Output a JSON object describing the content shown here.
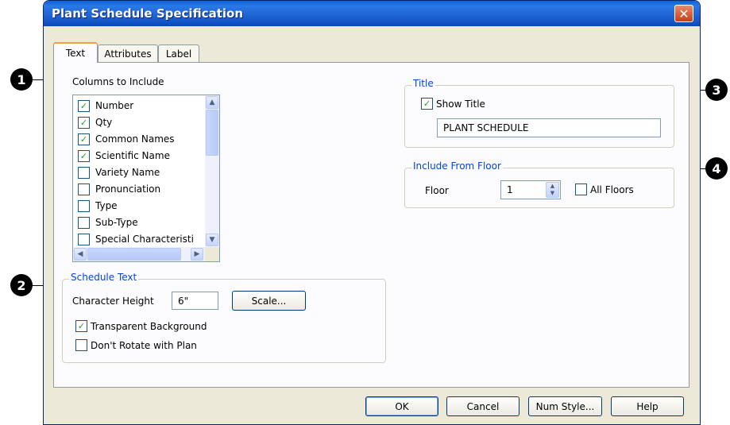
{
  "window": {
    "title": "Plant Schedule Specification"
  },
  "tabs": [
    {
      "label": "Text",
      "active": true
    },
    {
      "label": "Attributes",
      "active": false
    },
    {
      "label": "Label",
      "active": false
    }
  ],
  "columns": {
    "label": "Columns to Include",
    "items": [
      {
        "label": "Number",
        "checked": true
      },
      {
        "label": "Qty",
        "checked": true
      },
      {
        "label": "Common Names",
        "checked": true
      },
      {
        "label": "Scientific Name",
        "checked": true
      },
      {
        "label": "Variety Name",
        "checked": false
      },
      {
        "label": "Pronunciation",
        "checked": false
      },
      {
        "label": "Type",
        "checked": false
      },
      {
        "label": "Sub-Type",
        "checked": false
      },
      {
        "label": "Special Characteristi",
        "checked": false
      }
    ]
  },
  "schedule_text": {
    "legend": "Schedule Text",
    "char_height_label": "Character Height",
    "char_height_value": "6\"",
    "scale_button": "Scale...",
    "transparent_label": "Transparent Background",
    "transparent_checked": true,
    "dont_rotate_label": "Don't Rotate with Plan",
    "dont_rotate_checked": false
  },
  "title_group": {
    "legend": "Title",
    "show_title_label": "Show Title",
    "show_title_checked": true,
    "title_value": "PLANT SCHEDULE"
  },
  "floor_group": {
    "legend": "Include From Floor",
    "floor_label": "Floor",
    "floor_value": "1",
    "all_floors_label": "All Floors",
    "all_floors_checked": false
  },
  "buttons": {
    "ok": "OK",
    "cancel": "Cancel",
    "num_style": "Num Style...",
    "help": "Help"
  },
  "callouts": [
    "1",
    "2",
    "3",
    "4"
  ],
  "colors": {
    "titlebar": "#0a5fd8",
    "legend": "#0046d5",
    "dialog_bg": "#ece9d8",
    "check": "#21a121"
  }
}
